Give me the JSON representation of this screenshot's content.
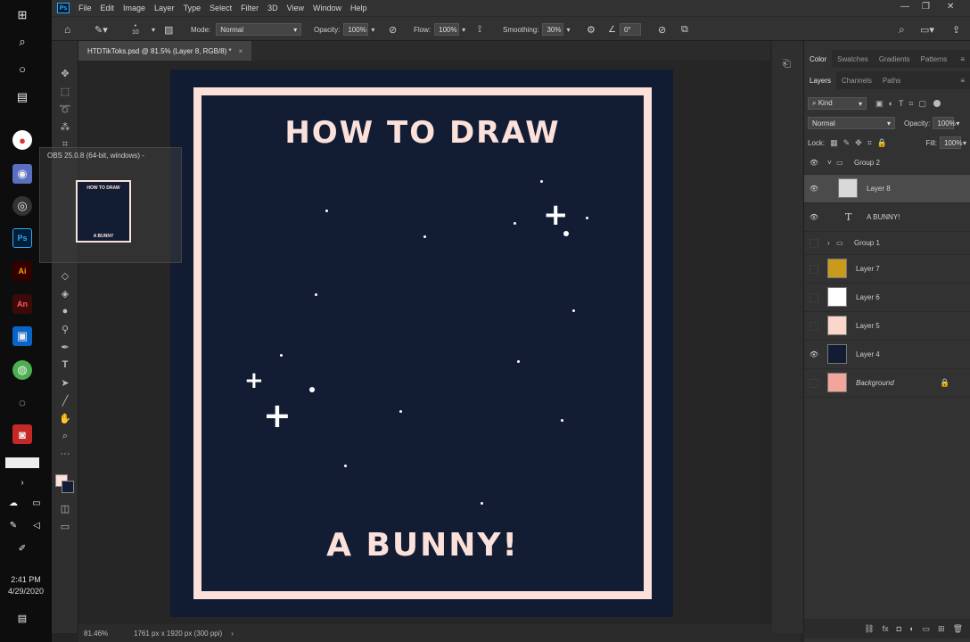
{
  "window": {
    "doc_tab": "HTDTikToks.psd @ 81.5% (Layer 8, RGB/8) *"
  },
  "menu": [
    "File",
    "Edit",
    "Image",
    "Layer",
    "Type",
    "Select",
    "Filter",
    "3D",
    "View",
    "Window",
    "Help"
  ],
  "options": {
    "brush_size": "10",
    "mode_label": "Mode:",
    "mode_value": "Normal",
    "opacity_label": "Opacity:",
    "opacity_value": "100%",
    "flow_label": "Flow:",
    "flow_value": "100%",
    "smoothing_label": "Smoothing:",
    "smoothing_value": "30%",
    "angle_value": "0°"
  },
  "canvas": {
    "title": "HOW TO DRAW",
    "subtitle": "A BUNNY!"
  },
  "status": {
    "zoom": "81.46%",
    "doc_size": "1761 px x 1920 px (300 ppi)"
  },
  "obs": {
    "label": "OBS 25.0.8 (64-bit, windows) -",
    "thumb_title": "HOW TO DRAW",
    "thumb_sub": "A BUNNY"
  },
  "taskbar": {
    "time": "2:41 PM",
    "date": "4/29/2020"
  },
  "panels": {
    "top_tabs": [
      "Color",
      "Swatches",
      "Gradients",
      "Patterns"
    ],
    "layer_tabs": [
      "Layers",
      "Channels",
      "Paths"
    ],
    "filter_kind": "Kind",
    "blend_mode": "Normal",
    "opacity_label": "Opacity:",
    "opacity_value": "100%",
    "lock_label": "Lock:",
    "fill_label": "Fill:",
    "fill_value": "100%"
  },
  "layers": [
    {
      "name": "Group 2",
      "kind": "group",
      "visible": true,
      "expanded": true
    },
    {
      "name": "Layer 8",
      "kind": "pixel",
      "visible": true,
      "selected": true,
      "thumb": "#d9d9d9"
    },
    {
      "name": "A BUNNY!",
      "kind": "text",
      "visible": true
    },
    {
      "name": "Group 1",
      "kind": "group",
      "visible": false
    },
    {
      "name": "Layer 7",
      "kind": "pixel",
      "visible": false,
      "thumb": "#c99a1b"
    },
    {
      "name": "Layer 6",
      "kind": "pixel",
      "visible": false,
      "thumb": "#ffffff"
    },
    {
      "name": "Layer 5",
      "kind": "pixel",
      "visible": false,
      "thumb": "#fbd6cb"
    },
    {
      "name": "Layer 4",
      "kind": "pixel",
      "visible": true,
      "thumb": "#121d34"
    },
    {
      "name": "Background",
      "kind": "pixel",
      "visible": false,
      "thumb": "#f2a59a",
      "locked": true
    }
  ],
  "colors": {
    "foreground": "#fbe1da",
    "background": "#121d34",
    "poster_border": "#fbe1da",
    "poster_bg": "#121d34"
  }
}
